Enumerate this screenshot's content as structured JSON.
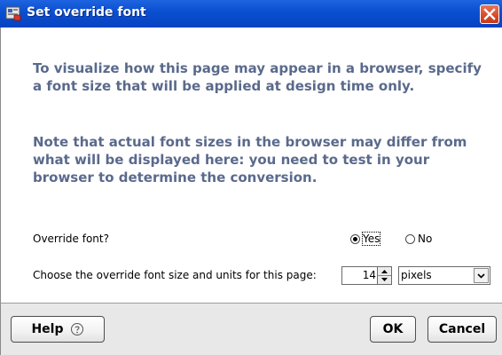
{
  "dialog": {
    "title": "Set override font"
  },
  "body": {
    "paragraph1": "To visualize how this page may appear in a browser, specify a font size that will be applied at design time only.",
    "paragraph2": "Note that actual font sizes in the browser may differ from what will be displayed here: you need to test in your browser to determine the conversion."
  },
  "override": {
    "label": "Override font?",
    "options": [
      {
        "label": "Yes",
        "selected": true
      },
      {
        "label": "No",
        "selected": false
      }
    ]
  },
  "font_size": {
    "label": "Choose the override font size and units for this page:",
    "value": "14",
    "units": "pixels"
  },
  "footer": {
    "help_label": "Help",
    "ok_label": "OK",
    "cancel_label": "Cancel"
  },
  "colors": {
    "titlebar": "#0a4ed1",
    "close_button": "#d6492a",
    "body_text": "#5a6a8c",
    "footer_bg": "#e8e8e8"
  },
  "icons": {
    "app": "app-icon",
    "close": "close-icon",
    "help": "help-circle-icon",
    "spin_up": "arrow-up-icon",
    "spin_down": "arrow-down-icon",
    "dropdown": "chevron-down-icon"
  }
}
